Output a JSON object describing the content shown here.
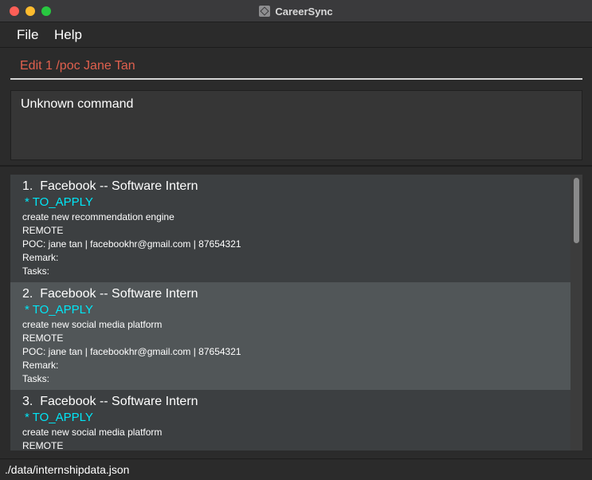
{
  "window": {
    "title": "CareerSync"
  },
  "menu": {
    "file": "File",
    "help": "Help"
  },
  "command": {
    "value": "Edit 1 /poc Jane Tan"
  },
  "result": {
    "message": "Unknown command"
  },
  "internships": [
    {
      "title": "1.  Facebook -- Software Intern",
      "status": "* TO_APPLY",
      "description": "create new recommendation engine",
      "location": "REMOTE",
      "poc": "POC: jane tan | facebookhr@gmail.com | 87654321",
      "remark": "Remark:",
      "tasks": "Tasks:"
    },
    {
      "title": "2.  Facebook -- Software Intern",
      "status": "* TO_APPLY",
      "description": "create new social media platform",
      "location": "REMOTE",
      "poc": "POC: jane tan | facebookhr@gmail.com | 87654321",
      "remark": "Remark:",
      "tasks": "Tasks:"
    },
    {
      "title": "3.  Facebook -- Software Intern",
      "status": "* TO_APPLY",
      "description": "create new social media platform",
      "location": "REMOTE",
      "poc": "",
      "remark": "",
      "tasks": ""
    }
  ],
  "status_bar": {
    "path": "./data/internshipdata.json"
  },
  "colors": {
    "command_text": "#e0604e",
    "status_accent": "#00e6f6",
    "background": "#2b2b2b"
  }
}
